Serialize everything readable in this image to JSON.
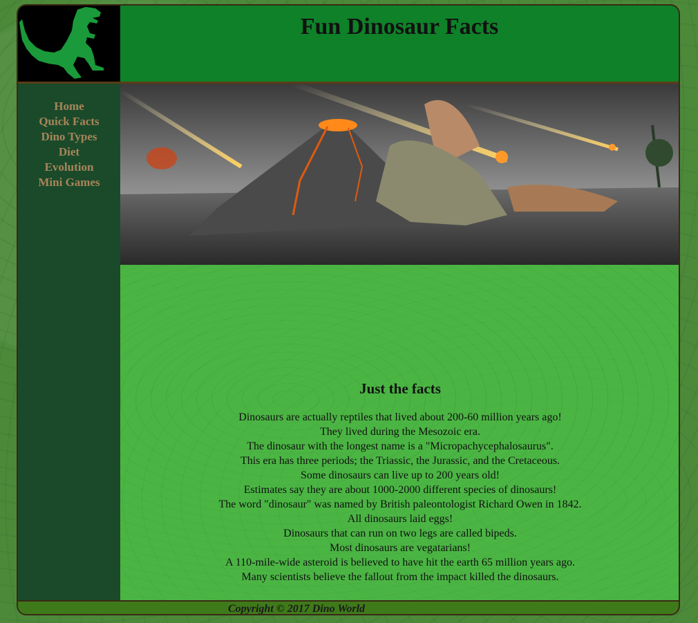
{
  "header": {
    "title": "Fun Dinosaur Facts",
    "logo_icon": "t-rex-silhouette-icon"
  },
  "sidebar": {
    "items": [
      {
        "label": "Home"
      },
      {
        "label": "Quick Facts"
      },
      {
        "label": "Dino Types"
      },
      {
        "label": "Diet"
      },
      {
        "label": "Evolution"
      },
      {
        "label": "Mini Games"
      }
    ]
  },
  "hero": {
    "image": "volcanic-landscape-with-dinosaurs-and-meteors"
  },
  "main": {
    "title": "Just the facts",
    "facts": [
      "Dinosaurs are actually reptiles that lived about 200-60 million years ago!",
      "They lived during the Mesozoic era.",
      "The dinosaur with the longest name is a \"Micropachycephalosaurus\".",
      "This era has three periods; the Triassic, the Jurassic, and the Cretaceous.",
      "Some dinosaurs can live up to 200 years old!",
      "Estimates say they are about 1000-2000 different species of dinosaurs!",
      "The word \"dinosaur\" was named by British paleontologist Richard Owen in 1842.",
      "All dinosaurs laid eggs!",
      "Dinosaurs that can run on two legs are called bipeds.",
      "Most dinosaurs are vegatarians!",
      "A 110-mile-wide asteroid is believed to have hit the earth 65 million years ago.",
      "Many scientists believe the fallout from the impact killed the dinosaurs."
    ]
  },
  "footer": {
    "copyright": "Copyright © 2017 Dino World"
  },
  "colors": {
    "header_bg": "#0f8129",
    "sidebar_bg": "#1b4a2a",
    "nav_text": "#a8855a",
    "content_bg": "#4bb544",
    "footer_bg": "#3f7a1a"
  }
}
